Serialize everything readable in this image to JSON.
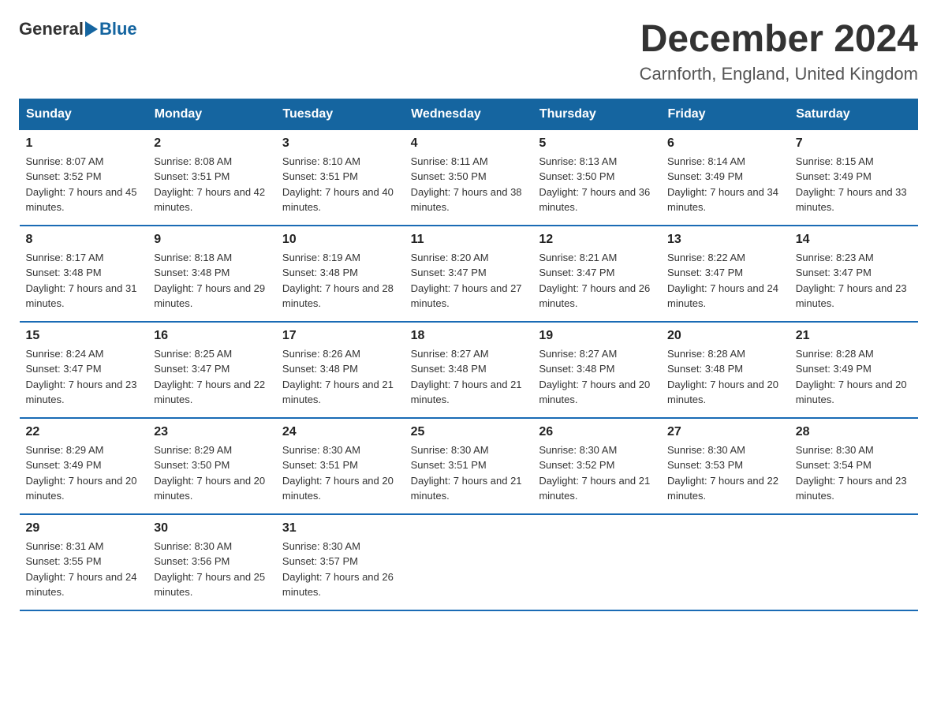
{
  "header": {
    "logo_general": "General",
    "logo_blue": "Blue",
    "month_title": "December 2024",
    "subtitle": "Carnforth, England, United Kingdom"
  },
  "weekdays": [
    "Sunday",
    "Monday",
    "Tuesday",
    "Wednesday",
    "Thursday",
    "Friday",
    "Saturday"
  ],
  "weeks": [
    [
      {
        "day": "1",
        "sunrise": "8:07 AM",
        "sunset": "3:52 PM",
        "daylight": "7 hours and 45 minutes."
      },
      {
        "day": "2",
        "sunrise": "8:08 AM",
        "sunset": "3:51 PM",
        "daylight": "7 hours and 42 minutes."
      },
      {
        "day": "3",
        "sunrise": "8:10 AM",
        "sunset": "3:51 PM",
        "daylight": "7 hours and 40 minutes."
      },
      {
        "day": "4",
        "sunrise": "8:11 AM",
        "sunset": "3:50 PM",
        "daylight": "7 hours and 38 minutes."
      },
      {
        "day": "5",
        "sunrise": "8:13 AM",
        "sunset": "3:50 PM",
        "daylight": "7 hours and 36 minutes."
      },
      {
        "day": "6",
        "sunrise": "8:14 AM",
        "sunset": "3:49 PM",
        "daylight": "7 hours and 34 minutes."
      },
      {
        "day": "7",
        "sunrise": "8:15 AM",
        "sunset": "3:49 PM",
        "daylight": "7 hours and 33 minutes."
      }
    ],
    [
      {
        "day": "8",
        "sunrise": "8:17 AM",
        "sunset": "3:48 PM",
        "daylight": "7 hours and 31 minutes."
      },
      {
        "day": "9",
        "sunrise": "8:18 AM",
        "sunset": "3:48 PM",
        "daylight": "7 hours and 29 minutes."
      },
      {
        "day": "10",
        "sunrise": "8:19 AM",
        "sunset": "3:48 PM",
        "daylight": "7 hours and 28 minutes."
      },
      {
        "day": "11",
        "sunrise": "8:20 AM",
        "sunset": "3:47 PM",
        "daylight": "7 hours and 27 minutes."
      },
      {
        "day": "12",
        "sunrise": "8:21 AM",
        "sunset": "3:47 PM",
        "daylight": "7 hours and 26 minutes."
      },
      {
        "day": "13",
        "sunrise": "8:22 AM",
        "sunset": "3:47 PM",
        "daylight": "7 hours and 24 minutes."
      },
      {
        "day": "14",
        "sunrise": "8:23 AM",
        "sunset": "3:47 PM",
        "daylight": "7 hours and 23 minutes."
      }
    ],
    [
      {
        "day": "15",
        "sunrise": "8:24 AM",
        "sunset": "3:47 PM",
        "daylight": "7 hours and 23 minutes."
      },
      {
        "day": "16",
        "sunrise": "8:25 AM",
        "sunset": "3:47 PM",
        "daylight": "7 hours and 22 minutes."
      },
      {
        "day": "17",
        "sunrise": "8:26 AM",
        "sunset": "3:48 PM",
        "daylight": "7 hours and 21 minutes."
      },
      {
        "day": "18",
        "sunrise": "8:27 AM",
        "sunset": "3:48 PM",
        "daylight": "7 hours and 21 minutes."
      },
      {
        "day": "19",
        "sunrise": "8:27 AM",
        "sunset": "3:48 PM",
        "daylight": "7 hours and 20 minutes."
      },
      {
        "day": "20",
        "sunrise": "8:28 AM",
        "sunset": "3:48 PM",
        "daylight": "7 hours and 20 minutes."
      },
      {
        "day": "21",
        "sunrise": "8:28 AM",
        "sunset": "3:49 PM",
        "daylight": "7 hours and 20 minutes."
      }
    ],
    [
      {
        "day": "22",
        "sunrise": "8:29 AM",
        "sunset": "3:49 PM",
        "daylight": "7 hours and 20 minutes."
      },
      {
        "day": "23",
        "sunrise": "8:29 AM",
        "sunset": "3:50 PM",
        "daylight": "7 hours and 20 minutes."
      },
      {
        "day": "24",
        "sunrise": "8:30 AM",
        "sunset": "3:51 PM",
        "daylight": "7 hours and 20 minutes."
      },
      {
        "day": "25",
        "sunrise": "8:30 AM",
        "sunset": "3:51 PM",
        "daylight": "7 hours and 21 minutes."
      },
      {
        "day": "26",
        "sunrise": "8:30 AM",
        "sunset": "3:52 PM",
        "daylight": "7 hours and 21 minutes."
      },
      {
        "day": "27",
        "sunrise": "8:30 AM",
        "sunset": "3:53 PM",
        "daylight": "7 hours and 22 minutes."
      },
      {
        "day": "28",
        "sunrise": "8:30 AM",
        "sunset": "3:54 PM",
        "daylight": "7 hours and 23 minutes."
      }
    ],
    [
      {
        "day": "29",
        "sunrise": "8:31 AM",
        "sunset": "3:55 PM",
        "daylight": "7 hours and 24 minutes."
      },
      {
        "day": "30",
        "sunrise": "8:30 AM",
        "sunset": "3:56 PM",
        "daylight": "7 hours and 25 minutes."
      },
      {
        "day": "31",
        "sunrise": "8:30 AM",
        "sunset": "3:57 PM",
        "daylight": "7 hours and 26 minutes."
      },
      null,
      null,
      null,
      null
    ]
  ]
}
